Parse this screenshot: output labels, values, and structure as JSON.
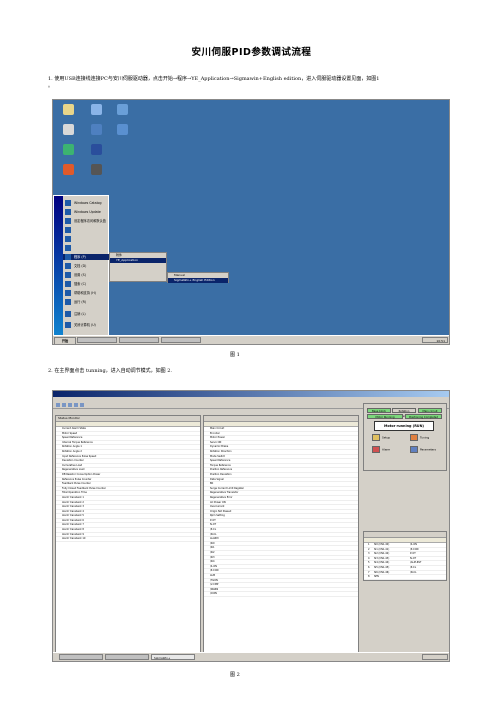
{
  "title": "安川伺服PID参数调试流程",
  "step1": "1. 使用USB连接线连接PC与安川伺服驱动器，点击开始→程序→YE_Application→Sigmawin+English edition，进入伺服驱动器设置见面，如图1",
  "step1_tail": "。",
  "caption1": "图 1",
  "step2": "2. 在主界面点击 tunning，进入自动调节模式，如图 2.",
  "caption2": "图 2",
  "fig1": {
    "start_menu": [
      {
        "label": "Windows Catalog",
        "sel": false
      },
      {
        "label": "Windows Update",
        "sel": false
      },
      {
        "label": "设定程序访问和默认值",
        "sel": false
      },
      {
        "label": "",
        "sel": false
      },
      {
        "label": "",
        "sel": false
      },
      {
        "label": "",
        "sel": false
      },
      {
        "label": "程序 (P)",
        "sel": true
      },
      {
        "label": "文档 (D)",
        "sel": false
      },
      {
        "label": "设置 (S)",
        "sel": false
      },
      {
        "label": "搜索 (C)",
        "sel": false
      },
      {
        "label": "帮助和支持 (H)",
        "sel": false
      },
      {
        "label": "运行 (R)",
        "sel": false
      },
      {
        "label": "注销 (L)",
        "sel": false
      },
      {
        "label": "关闭计算机 (U)",
        "sel": false
      }
    ],
    "programs_menu": [
      "附件",
      "",
      "",
      "",
      "YE_Application"
    ],
    "ye_menu": [
      "Manual",
      "SigmaWin+ English Edition"
    ],
    "start_label": "开始",
    "clock": "10:51"
  },
  "fig2": {
    "status_monitor_title": "Status Monitor",
    "status_monitor": [
      "Current Alarm State",
      "Motor Speed",
      "Speed Reference",
      "Internal Torque Reference",
      "Rotation Angle 1",
      "Rotation Angle 2",
      "Input Reference Pulse Speed",
      "Deviation Counter",
      "Cumulative Load",
      "Regenerative Load",
      "DB Resistor Consumption Power",
      "Reference Pulse Counter",
      "Feedback Pulse Counter",
      "Fully Closed Feedback Pulse Counter",
      "Total Operation Time",
      "Alarm traceback 1",
      "Alarm traceback 2",
      "Alarm traceback 3",
      "Alarm traceback 4",
      "Alarm traceback 5",
      "Alarm traceback 6",
      "Alarm traceback 7",
      "Alarm traceback 8",
      "Alarm traceback 9",
      "Alarm traceback 10"
    ],
    "signal_monitor": [
      "Main Circuit",
      "Encoder",
      "Motor Power",
      "Servo ON",
      "Dynamic Brake",
      "Rotation Direction",
      "Mode Switch",
      "Speed Reference",
      "Torque Reference",
      "Position Reference",
      "Position Deviation",
      "Data Signal",
      "BK",
      "Surge Current Limit Register",
      "Regenerative Transistor",
      "Regenerative Error",
      "AC Power ON",
      "Overcurrent",
      "Origin Not Passed",
      "Rpm Setting",
      "P-OT",
      "N-OT",
      "/P-CL",
      "/N-CL",
      "ALARM",
      "/SI0",
      "/SI1",
      "/SI2",
      "/SI3",
      "/SI4",
      "/S-ON",
      "/P-CON",
      "ALM",
      "/TGON",
      "/V-CMP",
      "/WARN",
      "/COIN"
    ],
    "running_text": "Motor running (RUN)",
    "state_boxes": [
      "Base block",
      "Rotation detected",
      "Main circuit",
      "Motor Running",
      "Positioning Completed"
    ],
    "controls": [
      "Setup",
      "Tuning",
      "Alarm",
      "Parameters"
    ],
    "input_signal": [
      {
        "num": "1",
        "name": "SI0 (CN1-40)",
        "sig": "/S-ON"
      },
      {
        "num": "2",
        "name": "SI1 (CN1-41)",
        "sig": "/P-CON"
      },
      {
        "num": "3",
        "name": "SI2 (CN1-42)",
        "sig": "P-OT"
      },
      {
        "num": "4",
        "name": "SI3 (CN1-43)",
        "sig": "N-OT"
      },
      {
        "num": "5",
        "name": "SI4 (CN1-44)",
        "sig": "/ALM-RST"
      },
      {
        "num": "6",
        "name": "SI5 (CN1-45)",
        "sig": "/P-CL"
      },
      {
        "num": "7",
        "name": "SI6 (CN1-46)",
        "sig": "/N-CL"
      },
      {
        "num": "8",
        "name": "SEN",
        "sig": ""
      }
    ],
    "taskbar_label": "SigmaWin+"
  }
}
